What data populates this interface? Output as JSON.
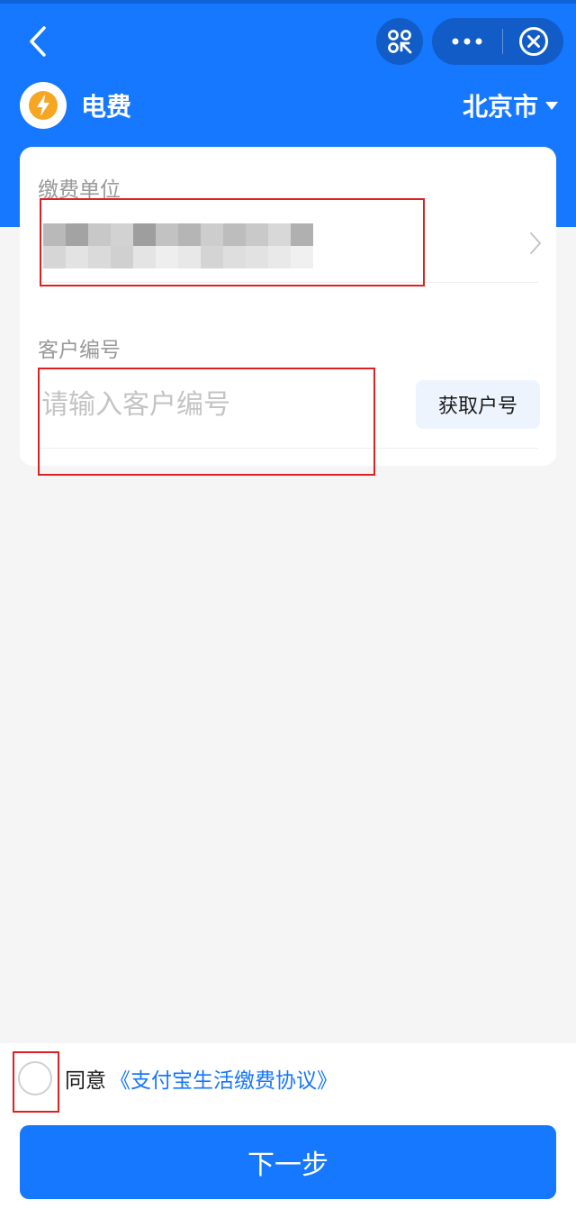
{
  "header": {
    "title": "电费",
    "city": "北京市",
    "back_icon": "chevron-left-icon",
    "scan_icon": "scan-icon",
    "more_icon": "more-horizontal-icon",
    "close_icon": "close-circle-icon",
    "logo_icon": "lightning-icon",
    "accent_color": "#1677ff",
    "logo_color": "#f5a623"
  },
  "form": {
    "unit_label": "缴费单位",
    "customer_label": "客户编号",
    "customer_placeholder": "请输入客户编号",
    "customer_value": "",
    "get_number_button": "获取户号"
  },
  "footer": {
    "agree_prefix": "同意",
    "agreement_link": "《支付宝生活缴费协议》",
    "agree_checked": false,
    "next_button": "下一步"
  }
}
